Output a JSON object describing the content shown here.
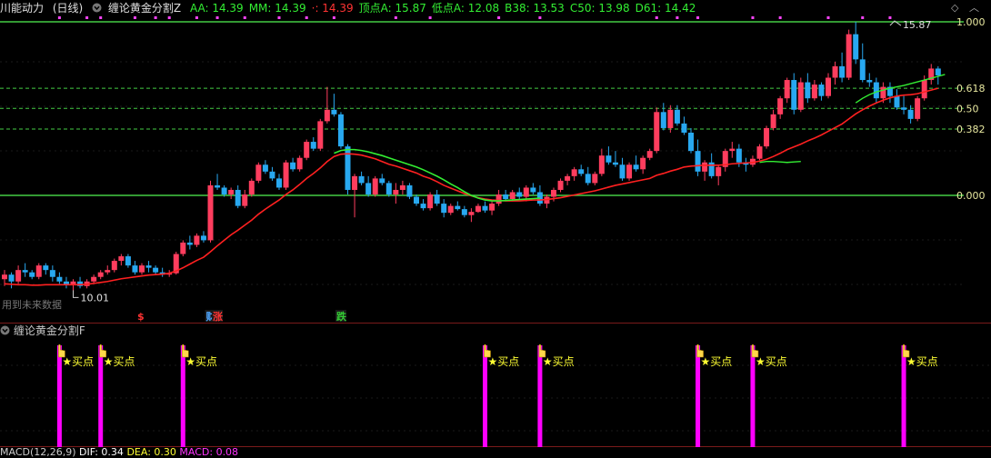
{
  "header": {
    "stock_name": "川能动力",
    "period": "(日线)",
    "indicator_name": "缠论黄金分割Z",
    "values": [
      {
        "label": "AA: 14.39",
        "color": "#ffffff"
      },
      {
        "label": "MM: 14.39",
        "color": "#ffffff"
      },
      {
        "label": "·: 14.39",
        "color": "#ff3333"
      },
      {
        "label": "顶点A: 15.87",
        "color": "#ffffff"
      },
      {
        "label": "低点A: 12.08",
        "color": "#ffffff"
      },
      {
        "label": "B38: 13.53",
        "color": "#ffffff"
      },
      {
        "label": "C50: 13.98",
        "color": "#ffffff"
      },
      {
        "label": "D61: 14.42",
        "color": "#ffffff"
      }
    ]
  },
  "main_chart": {
    "fib_labels": [
      {
        "text": "1.000",
        "value": 15.87
      },
      {
        "text": "0.618",
        "value": 14.42
      },
      {
        "text": "0.50",
        "value": 13.98
      },
      {
        "text": "0.382",
        "value": 13.53
      },
      {
        "text": "0.000",
        "value": 12.08
      }
    ],
    "peak_label": "15.87",
    "low_label": "10.01",
    "watermark": "用到未来数据",
    "markers": [
      {
        "text": "$",
        "idx": 20,
        "color": "#ff3333"
      },
      {
        "text": "财",
        "idx": 30,
        "color": "#4da6ff"
      },
      {
        "text": "涨",
        "idx": 31,
        "color": "#ff3333"
      },
      {
        "text": "跌",
        "idx": 49,
        "color": "#33cc33"
      }
    ]
  },
  "sub_panel": {
    "title": "缠论黄金分割F",
    "signal_label": "★买点",
    "signal_indices": [
      8,
      14,
      26,
      70,
      78,
      101,
      109,
      131
    ]
  },
  "bottom": {
    "text": "MACD(12,26,9)",
    "dif": "DIF: 0.34",
    "dea": "DEA: 0.30",
    "macd": "MACD: 0.08"
  },
  "colors": {
    "up": "#ff3d5e",
    "down": "#28a8f0",
    "ma_red": "#ff2020",
    "ma_green": "#33ee33",
    "fib_line": "#44cc44",
    "signal": "#ff00ff",
    "label_yellow": "#ffff33"
  },
  "chart_data": {
    "type": "candlestick",
    "ylim": [
      9.6,
      15.95
    ],
    "candles": [
      [
        10.25,
        10.45,
        10.1,
        10.35
      ],
      [
        10.35,
        10.4,
        10.05,
        10.2
      ],
      [
        10.2,
        10.55,
        10.15,
        10.45
      ],
      [
        10.45,
        10.6,
        10.3,
        10.4
      ],
      [
        10.4,
        10.45,
        10.25,
        10.3
      ],
      [
        10.3,
        10.6,
        10.25,
        10.55
      ],
      [
        10.55,
        10.6,
        10.35,
        10.45
      ],
      [
        10.45,
        10.55,
        10.2,
        10.3
      ],
      [
        10.3,
        10.4,
        10.15,
        10.2
      ],
      [
        10.2,
        10.3,
        10.05,
        10.12
      ],
      [
        10.12,
        10.25,
        10.0,
        10.2
      ],
      [
        10.2,
        10.3,
        10.05,
        10.1
      ],
      [
        10.1,
        10.25,
        10.05,
        10.2
      ],
      [
        10.2,
        10.35,
        10.15,
        10.3
      ],
      [
        10.3,
        10.45,
        10.25,
        10.4
      ],
      [
        10.4,
        10.55,
        10.35,
        10.45
      ],
      [
        10.45,
        10.7,
        10.4,
        10.65
      ],
      [
        10.65,
        10.8,
        10.55,
        10.75
      ],
      [
        10.75,
        10.8,
        10.5,
        10.55
      ],
      [
        10.55,
        10.65,
        10.35,
        10.4
      ],
      [
        10.4,
        10.6,
        10.35,
        10.55
      ],
      [
        10.55,
        10.65,
        10.4,
        10.5
      ],
      [
        10.5,
        10.55,
        10.35,
        10.4
      ],
      [
        10.4,
        10.5,
        10.3,
        10.35
      ],
      [
        10.35,
        10.45,
        10.3,
        10.38
      ],
      [
        10.38,
        10.85,
        10.35,
        10.8
      ],
      [
        10.8,
        11.1,
        10.75,
        11.05
      ],
      [
        11.05,
        11.2,
        10.9,
        11.0
      ],
      [
        11.0,
        11.25,
        10.95,
        11.2
      ],
      [
        11.2,
        11.3,
        11.05,
        11.1
      ],
      [
        11.1,
        12.4,
        11.05,
        12.3
      ],
      [
        12.3,
        12.55,
        12.2,
        12.25
      ],
      [
        12.25,
        12.3,
        12.05,
        12.1
      ],
      [
        12.1,
        12.25,
        12.0,
        12.2
      ],
      [
        12.2,
        12.3,
        11.8,
        11.85
      ],
      [
        11.85,
        12.2,
        11.8,
        12.1
      ],
      [
        12.1,
        12.45,
        12.05,
        12.4
      ],
      [
        12.4,
        12.8,
        12.35,
        12.75
      ],
      [
        12.75,
        12.85,
        12.55,
        12.6
      ],
      [
        12.6,
        12.7,
        12.4,
        12.45
      ],
      [
        12.45,
        12.55,
        12.2,
        12.25
      ],
      [
        12.25,
        12.85,
        12.2,
        12.8
      ],
      [
        12.8,
        12.9,
        12.6,
        12.65
      ],
      [
        12.65,
        12.95,
        12.6,
        12.9
      ],
      [
        12.9,
        13.3,
        12.85,
        13.25
      ],
      [
        13.25,
        13.35,
        13.05,
        13.1
      ],
      [
        13.1,
        13.75,
        13.05,
        13.7
      ],
      [
        13.7,
        14.45,
        13.65,
        13.95
      ],
      [
        13.95,
        14.3,
        13.8,
        13.85
      ],
      [
        13.85,
        13.9,
        13.1,
        13.15
      ],
      [
        13.15,
        13.2,
        12.1,
        12.2
      ],
      [
        12.2,
        12.55,
        11.6,
        12.5
      ],
      [
        12.5,
        12.6,
        12.3,
        12.35
      ],
      [
        12.35,
        12.5,
        12.05,
        12.1
      ],
      [
        12.1,
        12.5,
        12.05,
        12.45
      ],
      [
        12.45,
        12.55,
        12.3,
        12.35
      ],
      [
        12.35,
        12.4,
        12.05,
        12.1
      ],
      [
        12.1,
        12.35,
        11.9,
        12.2
      ],
      [
        12.2,
        12.4,
        12.1,
        12.3
      ],
      [
        12.3,
        12.35,
        12.0,
        12.05
      ],
      [
        12.05,
        12.1,
        11.85,
        11.9
      ],
      [
        11.9,
        12.0,
        11.75,
        11.8
      ],
      [
        11.8,
        12.15,
        11.75,
        12.1
      ],
      [
        12.1,
        12.2,
        11.85,
        11.9
      ],
      [
        11.9,
        12.0,
        11.6,
        11.7
      ],
      [
        11.7,
        11.9,
        11.65,
        11.85
      ],
      [
        11.85,
        11.95,
        11.75,
        11.78
      ],
      [
        11.78,
        11.85,
        11.6,
        11.65
      ],
      [
        11.65,
        11.8,
        11.5,
        11.72
      ],
      [
        11.72,
        11.9,
        11.7,
        11.85
      ],
      [
        11.85,
        11.95,
        11.7,
        11.75
      ],
      [
        11.75,
        11.95,
        11.65,
        11.9
      ],
      [
        11.9,
        12.2,
        11.85,
        12.1
      ],
      [
        12.1,
        12.2,
        11.95,
        12.0
      ],
      [
        12.0,
        12.2,
        11.95,
        12.15
      ],
      [
        12.15,
        12.25,
        12.0,
        12.05
      ],
      [
        12.05,
        12.3,
        11.95,
        12.25
      ],
      [
        12.25,
        12.35,
        12.1,
        12.15
      ],
      [
        12.15,
        12.3,
        11.85,
        11.9
      ],
      [
        11.9,
        12.1,
        11.8,
        12.05
      ],
      [
        12.05,
        12.25,
        11.95,
        12.2
      ],
      [
        12.2,
        12.45,
        12.15,
        12.4
      ],
      [
        12.4,
        12.55,
        12.3,
        12.5
      ],
      [
        12.5,
        12.7,
        12.4,
        12.65
      ],
      [
        12.65,
        12.75,
        12.5,
        12.55
      ],
      [
        12.55,
        12.7,
        12.3,
        12.35
      ],
      [
        12.35,
        12.6,
        12.3,
        12.55
      ],
      [
        12.55,
        13.1,
        12.5,
        12.95
      ],
      [
        12.95,
        13.15,
        12.75,
        12.8
      ],
      [
        12.8,
        13.05,
        12.7,
        12.75
      ],
      [
        12.75,
        12.9,
        12.4,
        12.45
      ],
      [
        12.45,
        12.8,
        12.4,
        12.75
      ],
      [
        12.75,
        12.95,
        12.6,
        12.65
      ],
      [
        12.65,
        12.95,
        12.55,
        12.9
      ],
      [
        12.9,
        13.1,
        12.85,
        13.05
      ],
      [
        13.05,
        14.0,
        13.0,
        13.9
      ],
      [
        13.9,
        14.1,
        13.5,
        13.55
      ],
      [
        13.55,
        14.05,
        13.45,
        13.95
      ],
      [
        13.95,
        14.05,
        13.6,
        13.65
      ],
      [
        13.65,
        13.8,
        13.4,
        13.45
      ],
      [
        13.45,
        13.55,
        13.0,
        13.05
      ],
      [
        13.05,
        13.3,
        12.5,
        12.6
      ],
      [
        12.6,
        12.85,
        12.4,
        12.8
      ],
      [
        12.8,
        13.0,
        12.45,
        12.5
      ],
      [
        12.5,
        12.75,
        12.3,
        12.7
      ],
      [
        12.7,
        13.1,
        12.6,
        13.05
      ],
      [
        13.05,
        13.25,
        12.9,
        13.1
      ],
      [
        13.1,
        13.2,
        12.7,
        12.8
      ],
      [
        12.8,
        12.9,
        12.6,
        12.75
      ],
      [
        12.75,
        12.95,
        12.7,
        12.88
      ],
      [
        12.88,
        13.2,
        12.85,
        13.15
      ],
      [
        13.15,
        13.6,
        13.1,
        13.55
      ],
      [
        13.55,
        13.95,
        13.5,
        13.85
      ],
      [
        13.85,
        14.25,
        13.75,
        14.2
      ],
      [
        14.2,
        14.65,
        14.1,
        14.6
      ],
      [
        14.6,
        14.75,
        13.85,
        13.95
      ],
      [
        13.95,
        14.65,
        13.9,
        14.55
      ],
      [
        14.55,
        14.75,
        14.1,
        14.2
      ],
      [
        14.2,
        14.6,
        14.15,
        14.5
      ],
      [
        14.5,
        14.55,
        14.15,
        14.25
      ],
      [
        14.25,
        14.75,
        14.2,
        14.65
      ],
      [
        14.65,
        15.0,
        14.5,
        14.9
      ],
      [
        14.9,
        15.2,
        14.55,
        14.65
      ],
      [
        14.65,
        15.7,
        14.6,
        15.6
      ],
      [
        15.6,
        15.87,
        14.95,
        15.05
      ],
      [
        15.05,
        15.4,
        14.55,
        14.6
      ],
      [
        14.6,
        14.75,
        14.45,
        14.55
      ],
      [
        14.55,
        14.65,
        14.1,
        14.2
      ],
      [
        14.2,
        14.55,
        14.1,
        14.45
      ],
      [
        14.45,
        14.55,
        14.1,
        14.25
      ],
      [
        14.25,
        14.4,
        13.95,
        14.0
      ],
      [
        14.0,
        14.25,
        13.85,
        13.95
      ],
      [
        13.95,
        14.05,
        13.65,
        13.75
      ],
      [
        13.75,
        14.25,
        13.7,
        14.2
      ],
      [
        14.2,
        14.7,
        14.15,
        14.6
      ],
      [
        14.6,
        14.95,
        14.5,
        14.85
      ],
      [
        14.85,
        14.9,
        14.5,
        14.7
      ]
    ],
    "ma_red": [
      10.15,
      10.14,
      10.13,
      10.13,
      10.12,
      10.12,
      10.13,
      10.13,
      10.13,
      10.13,
      10.13,
      10.13,
      10.14,
      10.16,
      10.18,
      10.2,
      10.23,
      10.26,
      10.28,
      10.3,
      10.32,
      10.34,
      10.35,
      10.36,
      10.38,
      10.43,
      10.5,
      10.58,
      10.66,
      10.73,
      10.85,
      10.98,
      11.1,
      11.22,
      11.32,
      11.43,
      11.54,
      11.67,
      11.78,
      11.88,
      11.98,
      12.1,
      12.2,
      12.32,
      12.45,
      12.56,
      12.68,
      12.82,
      12.93,
      12.98,
      12.99,
      12.98,
      12.96,
      12.92,
      12.88,
      12.82,
      12.76,
      12.72,
      12.67,
      12.62,
      12.57,
      12.5,
      12.45,
      12.38,
      12.3,
      12.24,
      12.18,
      12.12,
      12.07,
      12.03,
      12.0,
      11.98,
      11.97,
      11.96,
      11.96,
      11.96,
      11.97,
      11.98,
      11.98,
      11.99,
      12.01,
      12.03,
      12.06,
      12.09,
      12.12,
      12.15,
      12.18,
      12.22,
      12.26,
      12.3,
      12.33,
      12.36,
      12.39,
      12.42,
      12.45,
      12.52,
      12.56,
      12.61,
      12.65,
      12.7,
      12.72,
      12.73,
      12.74,
      12.74,
      12.74,
      12.75,
      12.77,
      12.78,
      12.79,
      12.8,
      12.83,
      12.87,
      12.93,
      13.0,
      13.08,
      13.14,
      13.2,
      13.27,
      13.33,
      13.4,
      13.48,
      13.56,
      13.64,
      13.75,
      13.86,
      13.95,
      14.03,
      14.1,
      14.16,
      14.21,
      14.25,
      14.27,
      14.28,
      14.3,
      14.34,
      14.38,
      14.42
    ],
    "ma_green_start": 48,
    "ma_green_end": 78,
    "ma_green": [
      13.0,
      13.06,
      13.08,
      13.08,
      13.06,
      13.03,
      12.99,
      12.95,
      12.9,
      12.85,
      12.8,
      12.75,
      12.7,
      12.64,
      12.57,
      12.5,
      12.42,
      12.33,
      12.25,
      12.16,
      12.08,
      12.02,
      11.98,
      11.96,
      11.96,
      11.97,
      11.98,
      11.99,
      12.0,
      12.01,
      12.02
    ],
    "ma_green2_start": 110,
    "ma_green2_end": 127,
    "ma_green2": [
      12.8,
      12.82,
      12.82,
      12.81,
      12.8,
      12.81,
      12.82
    ],
    "ma_green3_start": 124,
    "ma_green3": [
      14.1,
      14.2,
      14.28,
      14.34,
      14.38,
      14.42,
      14.45,
      14.48,
      14.52,
      14.56,
      14.6,
      14.64,
      14.68,
      14.72
    ]
  }
}
